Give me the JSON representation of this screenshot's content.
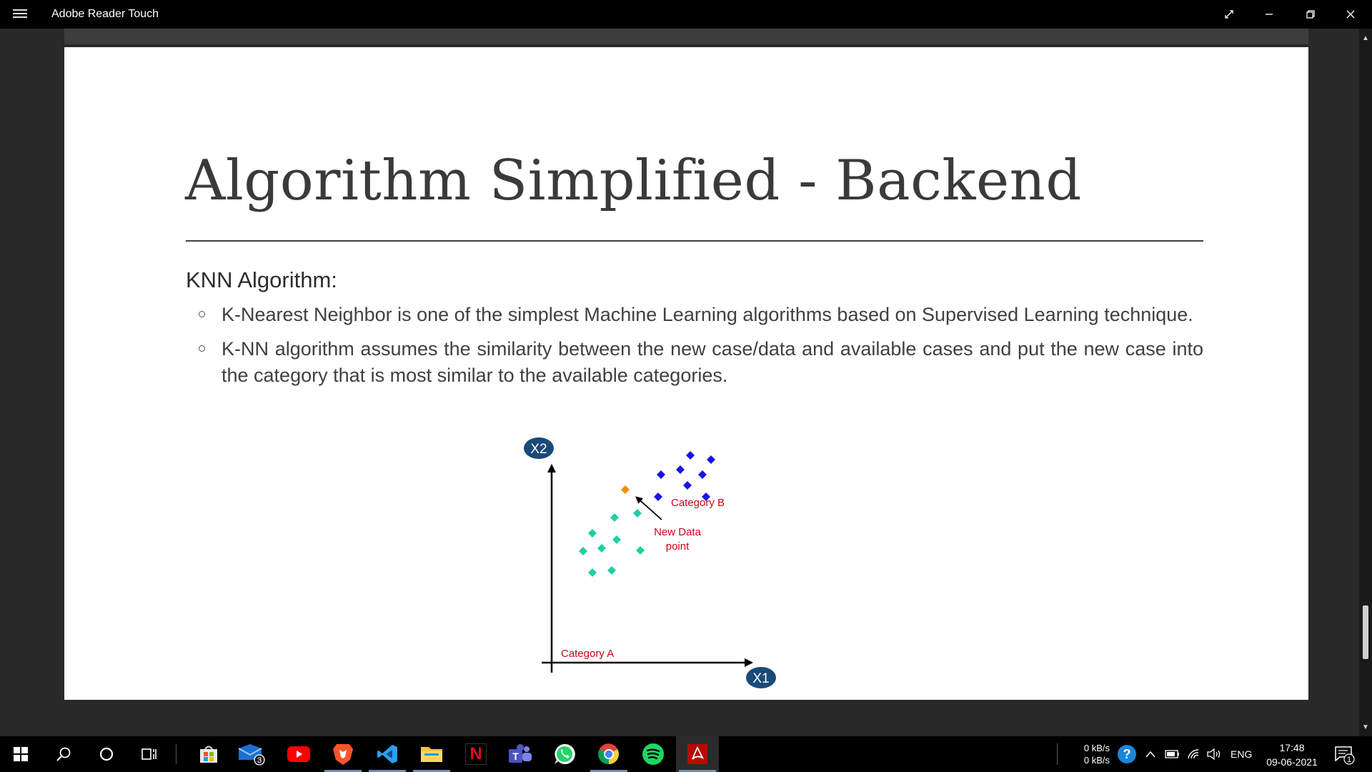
{
  "window": {
    "title": "Adobe Reader Touch"
  },
  "slide": {
    "title": "Algorithm Simplified - Backend",
    "subheading": "KNN Algorithm:",
    "bullets": [
      "K-Nearest Neighbor is one of the simplest Machine Learning algorithms based on Supervised Learning technique.",
      "K-NN algorithm assumes the similarity between the new case/data and available cases and put the new case into the category that is most similar to the available categories."
    ]
  },
  "diagram": {
    "y_axis_label": "X2",
    "x_axis_label": "X1",
    "category_a_label": "Category A",
    "category_b_label": "Category B",
    "new_point_label_line1": "New Data",
    "new_point_label_line2": "point",
    "colors": {
      "category_a": "#1fcfa3",
      "category_b": "#1414e6",
      "new_point": "#f28c00",
      "labels": "#d0021b",
      "axis_badge": "#1a4a78"
    }
  },
  "taskbar": {
    "apps": [
      {
        "name": "microsoft-store",
        "icon": "store-icon"
      },
      {
        "name": "mail",
        "icon": "mail-icon",
        "badge": "3"
      },
      {
        "name": "youtube",
        "icon": "youtube-icon"
      },
      {
        "name": "brave",
        "icon": "brave-icon"
      },
      {
        "name": "vscode",
        "icon": "vscode-icon"
      },
      {
        "name": "file-explorer",
        "icon": "folder-icon"
      },
      {
        "name": "netflix",
        "icon": "netflix-icon",
        "label": "N"
      },
      {
        "name": "teams",
        "icon": "teams-icon"
      },
      {
        "name": "whatsapp",
        "icon": "whatsapp-icon"
      },
      {
        "name": "chrome",
        "icon": "chrome-icon"
      },
      {
        "name": "spotify",
        "icon": "spotify-icon"
      },
      {
        "name": "adobe-reader",
        "icon": "adobe-icon"
      }
    ],
    "net_up": "0 kB/s",
    "net_down": "0 kB/s",
    "language": "ENG",
    "time": "17:48",
    "date": "09-06-2021",
    "notifications": "1"
  }
}
